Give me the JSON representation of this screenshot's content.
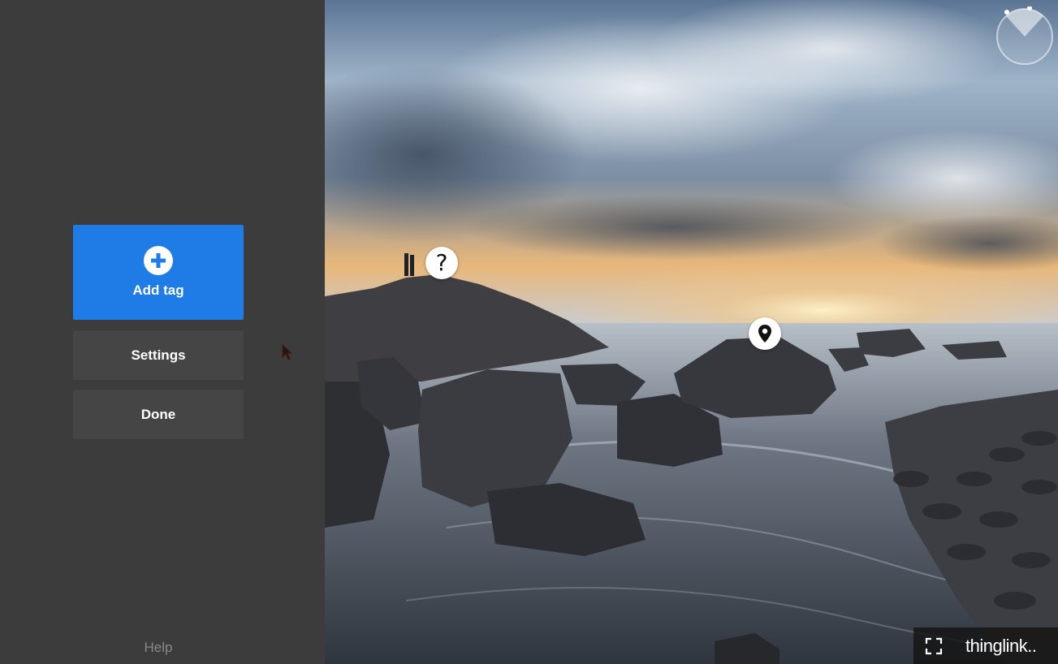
{
  "sidebar": {
    "add_tag_label": "Add tag",
    "settings_label": "Settings",
    "done_label": "Done",
    "help_label": "Help"
  },
  "viewer": {
    "hotspots": [
      {
        "type": "question",
        "icon": "question-icon",
        "glyph": "?"
      },
      {
        "type": "location",
        "icon": "map-pin-icon"
      }
    ],
    "compass_icon": "compass-icon",
    "fullscreen_icon": "fullscreen-icon",
    "brand": "thinglink.."
  },
  "colors": {
    "sidebar_bg": "#3c3c3c",
    "accent": "#1f7ce6",
    "secondary_button": "#454545",
    "help_text": "#8a8a8a"
  }
}
